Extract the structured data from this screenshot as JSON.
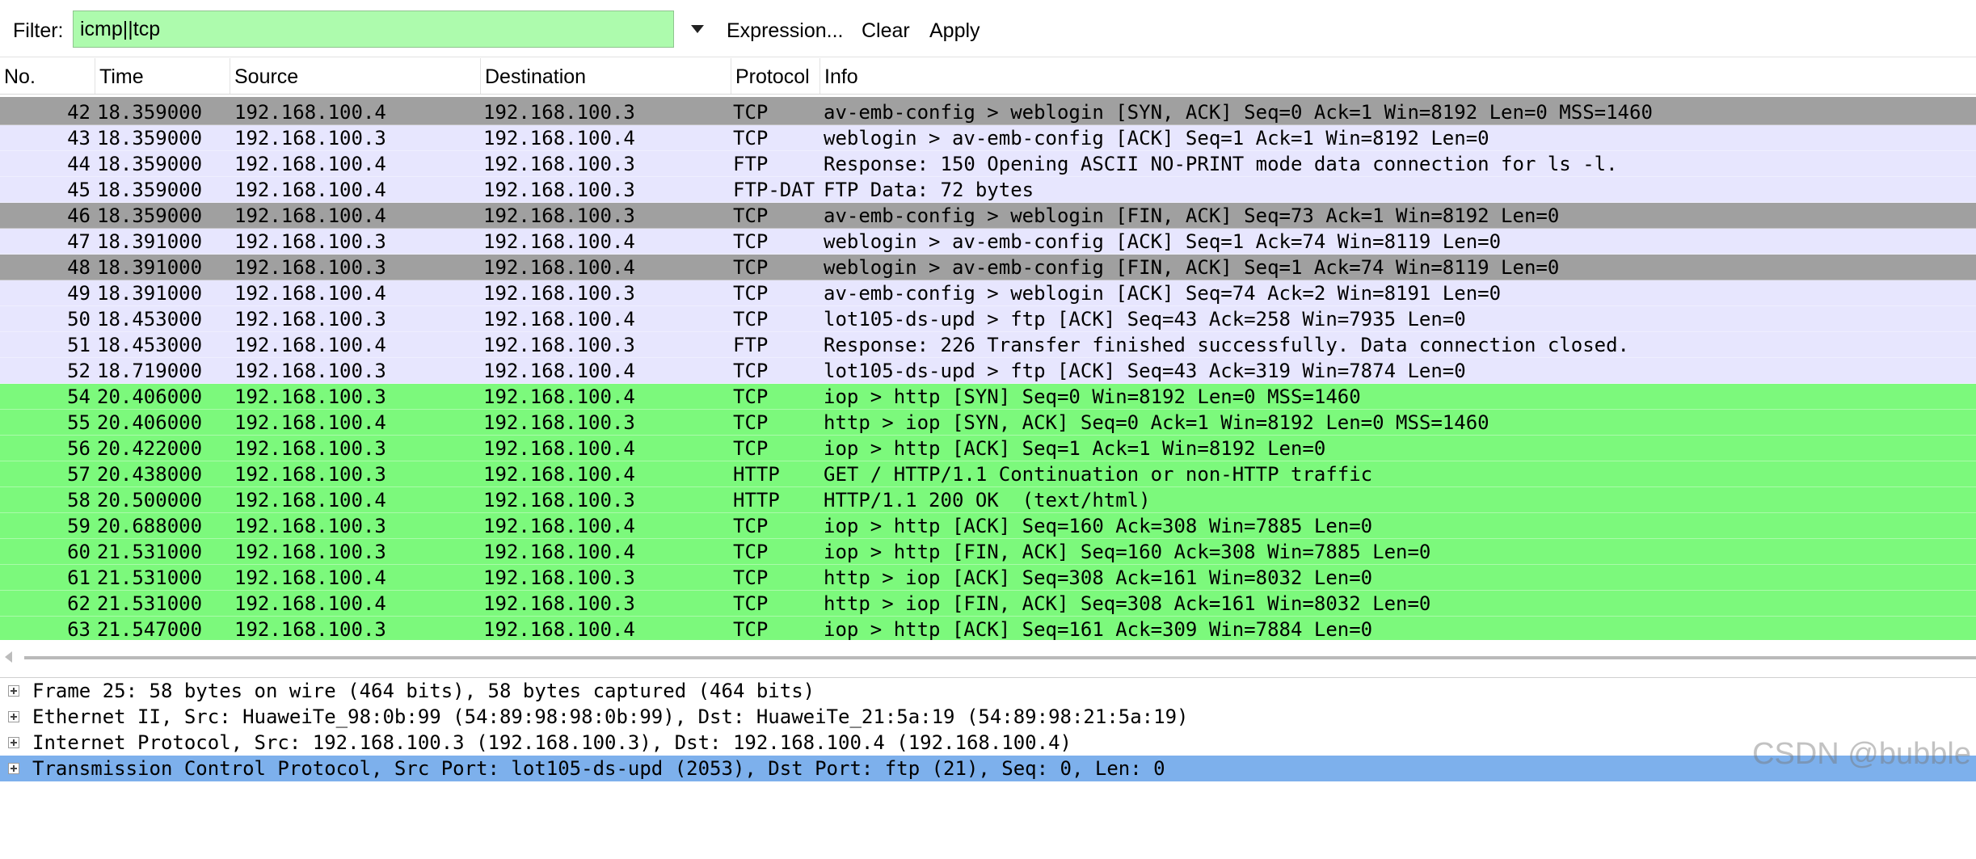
{
  "toolbar": {
    "filter_label": "Filter:",
    "filter_value": "icmp||tcp",
    "expression_label": "Expression...",
    "clear_label": "Clear",
    "apply_label": "Apply"
  },
  "columns": {
    "no": "No.",
    "time": "Time",
    "source": "Source",
    "destination": "Destination",
    "protocol": "Protocol",
    "info": "Info"
  },
  "colors": {
    "gray_row": "#a0a0a0",
    "lavender_row": "#e7e6fe",
    "green_row": "#7cf97c",
    "selected_detail": "#7db0ec",
    "filter_bg": "#adfbad"
  },
  "packets": [
    {
      "no": "42",
      "time": "18.359000",
      "source": "192.168.100.4",
      "destination": "192.168.100.3",
      "protocol": "TCP",
      "info": "av-emb-config > weblogin [SYN, ACK] Seq=0 Ack=1 Win=8192 Len=0 MSS=1460",
      "color": "#a0a0a0"
    },
    {
      "no": "43",
      "time": "18.359000",
      "source": "192.168.100.3",
      "destination": "192.168.100.4",
      "protocol": "TCP",
      "info": "weblogin > av-emb-config [ACK] Seq=1 Ack=1 Win=8192 Len=0",
      "color": "#e7e6fe"
    },
    {
      "no": "44",
      "time": "18.359000",
      "source": "192.168.100.4",
      "destination": "192.168.100.3",
      "protocol": "FTP",
      "info": "Response: 150 Opening ASCII NO-PRINT mode data connection for ls -l.",
      "color": "#e7e6fe"
    },
    {
      "no": "45",
      "time": "18.359000",
      "source": "192.168.100.4",
      "destination": "192.168.100.3",
      "protocol": "FTP-DAT",
      "info": "FTP Data: 72 bytes",
      "color": "#e7e6fe"
    },
    {
      "no": "46",
      "time": "18.359000",
      "source": "192.168.100.4",
      "destination": "192.168.100.3",
      "protocol": "TCP",
      "info": "av-emb-config > weblogin [FIN, ACK] Seq=73 Ack=1 Win=8192 Len=0",
      "color": "#a0a0a0"
    },
    {
      "no": "47",
      "time": "18.391000",
      "source": "192.168.100.3",
      "destination": "192.168.100.4",
      "protocol": "TCP",
      "info": "weblogin > av-emb-config [ACK] Seq=1 Ack=74 Win=8119 Len=0",
      "color": "#e7e6fe"
    },
    {
      "no": "48",
      "time": "18.391000",
      "source": "192.168.100.3",
      "destination": "192.168.100.4",
      "protocol": "TCP",
      "info": "weblogin > av-emb-config [FIN, ACK] Seq=1 Ack=74 Win=8119 Len=0",
      "color": "#a0a0a0"
    },
    {
      "no": "49",
      "time": "18.391000",
      "source": "192.168.100.4",
      "destination": "192.168.100.3",
      "protocol": "TCP",
      "info": "av-emb-config > weblogin [ACK] Seq=74 Ack=2 Win=8191 Len=0",
      "color": "#e7e6fe"
    },
    {
      "no": "50",
      "time": "18.453000",
      "source": "192.168.100.3",
      "destination": "192.168.100.4",
      "protocol": "TCP",
      "info": "lot105-ds-upd > ftp [ACK] Seq=43 Ack=258 Win=7935 Len=0",
      "color": "#e7e6fe"
    },
    {
      "no": "51",
      "time": "18.453000",
      "source": "192.168.100.4",
      "destination": "192.168.100.3",
      "protocol": "FTP",
      "info": "Response: 226 Transfer finished successfully. Data connection closed.",
      "color": "#e7e6fe"
    },
    {
      "no": "52",
      "time": "18.719000",
      "source": "192.168.100.3",
      "destination": "192.168.100.4",
      "protocol": "TCP",
      "info": "lot105-ds-upd > ftp [ACK] Seq=43 Ack=319 Win=7874 Len=0",
      "color": "#e7e6fe"
    },
    {
      "no": "54",
      "time": "20.406000",
      "source": "192.168.100.3",
      "destination": "192.168.100.4",
      "protocol": "TCP",
      "info": "iop > http [SYN] Seq=0 Win=8192 Len=0 MSS=1460",
      "color": "#7cf97c"
    },
    {
      "no": "55",
      "time": "20.406000",
      "source": "192.168.100.4",
      "destination": "192.168.100.3",
      "protocol": "TCP",
      "info": "http > iop [SYN, ACK] Seq=0 Ack=1 Win=8192 Len=0 MSS=1460",
      "color": "#7cf97c"
    },
    {
      "no": "56",
      "time": "20.422000",
      "source": "192.168.100.3",
      "destination": "192.168.100.4",
      "protocol": "TCP",
      "info": "iop > http [ACK] Seq=1 Ack=1 Win=8192 Len=0",
      "color": "#7cf97c"
    },
    {
      "no": "57",
      "time": "20.438000",
      "source": "192.168.100.3",
      "destination": "192.168.100.4",
      "protocol": "HTTP",
      "info": "GET / HTTP/1.1 Continuation or non-HTTP traffic",
      "color": "#7cf97c"
    },
    {
      "no": "58",
      "time": "20.500000",
      "source": "192.168.100.4",
      "destination": "192.168.100.3",
      "protocol": "HTTP",
      "info": "HTTP/1.1 200 OK  (text/html)",
      "color": "#7cf97c"
    },
    {
      "no": "59",
      "time": "20.688000",
      "source": "192.168.100.3",
      "destination": "192.168.100.4",
      "protocol": "TCP",
      "info": "iop > http [ACK] Seq=160 Ack=308 Win=7885 Len=0",
      "color": "#7cf97c"
    },
    {
      "no": "60",
      "time": "21.531000",
      "source": "192.168.100.3",
      "destination": "192.168.100.4",
      "protocol": "TCP",
      "info": "iop > http [FIN, ACK] Seq=160 Ack=308 Win=7885 Len=0",
      "color": "#7cf97c"
    },
    {
      "no": "61",
      "time": "21.531000",
      "source": "192.168.100.4",
      "destination": "192.168.100.3",
      "protocol": "TCP",
      "info": "http > iop [ACK] Seq=308 Ack=161 Win=8032 Len=0",
      "color": "#7cf97c"
    },
    {
      "no": "62",
      "time": "21.531000",
      "source": "192.168.100.4",
      "destination": "192.168.100.3",
      "protocol": "TCP",
      "info": "http > iop [FIN, ACK] Seq=308 Ack=161 Win=8032 Len=0",
      "color": "#7cf97c"
    },
    {
      "no": "63",
      "time": "21.547000",
      "source": "192.168.100.3",
      "destination": "192.168.100.4",
      "protocol": "TCP",
      "info": "iop > http [ACK] Seq=161 Ack=309 Win=7884 Len=0",
      "color": "#7cf97c"
    }
  ],
  "details": [
    {
      "text": "Frame 25: 58 bytes on wire (464 bits), 58 bytes captured (464 bits)",
      "selected": false
    },
    {
      "text": "Ethernet II, Src: HuaweiTe_98:0b:99 (54:89:98:98:0b:99), Dst: HuaweiTe_21:5a:19 (54:89:98:21:5a:19)",
      "selected": false
    },
    {
      "text": "Internet Protocol, Src: 192.168.100.3 (192.168.100.3), Dst: 192.168.100.4 (192.168.100.4)",
      "selected": false
    },
    {
      "text": "Transmission Control Protocol, Src Port: lot105-ds-upd (2053), Dst Port: ftp (21), Seq: 0, Len: 0",
      "selected": true
    }
  ],
  "watermark": "CSDN @bubble"
}
